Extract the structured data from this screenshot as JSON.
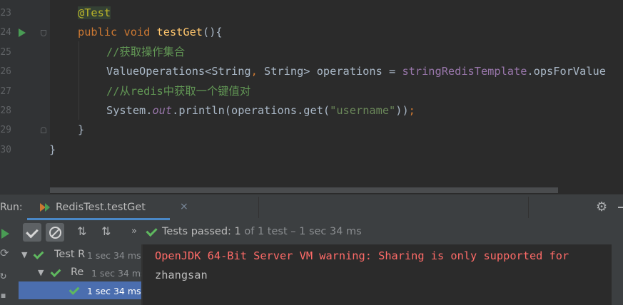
{
  "editor": {
    "lines": [
      {
        "number": "23",
        "has_run_marker": false
      },
      {
        "number": "24",
        "has_run_marker": true
      },
      {
        "number": "25",
        "has_run_marker": false
      },
      {
        "number": "26",
        "has_run_marker": false
      },
      {
        "number": "27",
        "has_run_marker": false
      },
      {
        "number": "28",
        "has_run_marker": false
      },
      {
        "number": "29",
        "has_run_marker": false
      },
      {
        "number": "30",
        "has_run_marker": false
      }
    ],
    "code": {
      "annotation": "@Test",
      "kw_public": "public",
      "kw_void": "void",
      "method_name": "testGet",
      "sig_rest": "(){",
      "comment_1": "//获取操作集合",
      "decl_type": "ValueOperations<String",
      "decl_comma": ",",
      "decl_type2": " String> operations = ",
      "decl_field": "stringRedisTemplate",
      "decl_call": ".opsForValue",
      "comment_2": "//从redis中获取一个键值对",
      "print_system": "System.",
      "print_out": "out",
      "print_rest": ".println(operations.get(",
      "print_string": "\"username\"",
      "print_close": "))",
      "print_semicolon": ";",
      "close_method": "}",
      "close_class": "}"
    }
  },
  "run_panel": {
    "label": "Run:",
    "tab_title": "RedisTest.testGet",
    "tab_close": "×",
    "status_main": "Tests passed: 1",
    "status_detail": " of 1 test – 1 sec 34 ms",
    "tree": [
      {
        "name": "Test R",
        "time": "1 sec 34 ms",
        "expanded": true,
        "selected": false
      },
      {
        "name": "Re",
        "time": "1 sec 34 ms",
        "expanded": true,
        "selected": false
      },
      {
        "name": "",
        "time": "1 sec 34 ms",
        "expanded": false,
        "selected": true
      }
    ],
    "console": [
      {
        "text": "OpenJDK 64-Bit Server VM warning: Sharing is only supported for",
        "kind": "warning"
      },
      {
        "text": "zhangsan",
        "kind": "output"
      }
    ]
  },
  "colors": {
    "editor_bg": "#2b2b2b",
    "panel_bg": "#3c3f41",
    "selection": "#4b6eaf",
    "pass_green": "#5fb85f",
    "warning_red": "#ff6b68"
  },
  "icons": [
    "run-gutter-icon",
    "fold-icon",
    "gear-icon",
    "minimize-icon",
    "rerun-icon",
    "show-passed-icon",
    "show-ignored-icon",
    "sort-alpha-icon",
    "sort-duration-icon",
    "expand-chevron-icon",
    "pass-check-icon"
  ]
}
